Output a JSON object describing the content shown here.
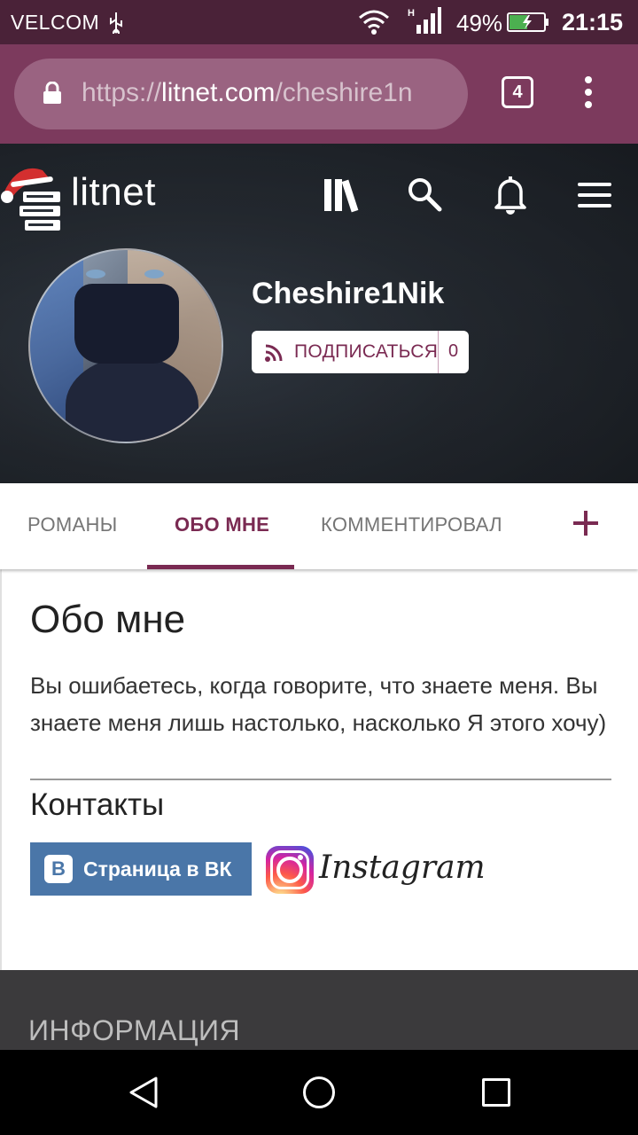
{
  "status_bar": {
    "carrier": "VELCOM",
    "battery_percent": "49%",
    "time": "21:15"
  },
  "browser": {
    "url_prefix": "https://",
    "url_host": "litnet.com",
    "url_path": "/cheshire1n",
    "tab_count": "4"
  },
  "header": {
    "logo_text": "litnet",
    "icons": [
      "library-icon",
      "search-icon",
      "bell-icon",
      "hamburger-menu-icon"
    ]
  },
  "profile": {
    "username": "Cheshire1Nik",
    "subscribe_label": "ПОДПИСАТЬСЯ",
    "subscribers_count": "0"
  },
  "tabs": {
    "items": [
      {
        "label": "РОМАНЫ"
      },
      {
        "label": "ОБО МНЕ"
      },
      {
        "label": "КОММЕНТИРОВАЛ"
      }
    ],
    "active_index": 1,
    "add_icon": "plus-icon"
  },
  "about": {
    "title": "Обо мне",
    "text": "Вы ошибаетесь, когда говорите, что знаете меня. Вы знаете меня лишь настолько, насколько Я этого хочу)",
    "contacts_title": "Контакты",
    "vk_logo": "В",
    "vk_label": "Страница в ВК",
    "instagram_label": "Instagram"
  },
  "footer": {
    "title": "ИНФОРМАЦИЯ"
  },
  "colors": {
    "brand": "#7a2a52",
    "status_bar": "#4a2238",
    "url_bar": "#7c3a5d",
    "vk": "#4a76a8"
  }
}
